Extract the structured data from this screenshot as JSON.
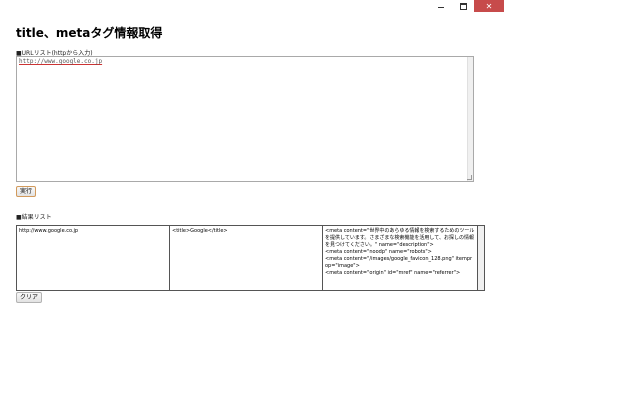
{
  "window": {
    "minimize_icon": "minimize-icon",
    "maximize_icon": "maximize-icon",
    "close_icon": "close-icon",
    "close_glyph": "✕",
    "close_color": "#c74b4b"
  },
  "page": {
    "title": "title、metaタグ情報取得"
  },
  "url_section": {
    "label": "■URLリスト(httpから入力)",
    "value": "http://www.google.co.jp"
  },
  "run_button": {
    "label": "実行"
  },
  "result_section": {
    "label": "■結果リスト",
    "rows": [
      {
        "url": "http://www.google.co.jp",
        "title_tag": "<title>Google</title>",
        "meta_lines": [
          "<meta content=\"世界中のあらゆる情報を検索するためのツールを提供しています。さまざまな検索機能を活用して、お探しの情報を見つけてください。\" name=\"description\">",
          "<meta content=\"noodp\" name=\"robots\">",
          "<meta content=\"/images/google_favicon_128.png\" itemprop=\"image\">",
          "<meta content=\"origin\" id=\"mref\" name=\"referrer\">"
        ]
      }
    ]
  },
  "clear_button": {
    "label": "クリア"
  }
}
